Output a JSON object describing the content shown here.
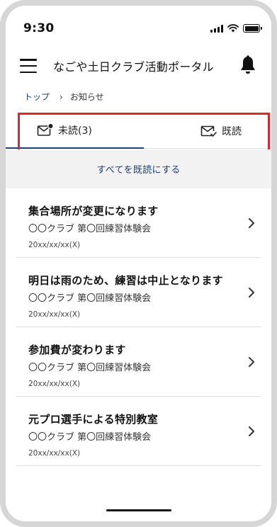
{
  "status_bar": {
    "time": "9:30"
  },
  "header": {
    "title": "なごや土日クラブ活動ポータル"
  },
  "breadcrumb": {
    "home": "トップ",
    "separator": "›",
    "current": "お知らせ"
  },
  "tabs": {
    "unread": "未読(3)",
    "read": "既読"
  },
  "mark_all_read": "すべてを既読にする",
  "notices": [
    {
      "title": "集合場所が変更になります",
      "club": "〇〇クラブ 第〇回練習体験会",
      "date": "20xx/xx/xx(X)"
    },
    {
      "title": "明日は雨のため、練習は中止となります",
      "club": "〇〇クラブ 第〇回練習体験会",
      "date": "20xx/xx/xx(X)"
    },
    {
      "title": "参加費が変わります",
      "club": "〇〇クラブ 第〇回練習体験会",
      "date": "20xx/xx/xx(X)"
    },
    {
      "title": "元プロ選手による特別教室",
      "club": "〇〇クラブ 第〇回練習体験会",
      "date": "20xx/xx/xx(X)"
    }
  ],
  "colors": {
    "accent": "#1f3f6e",
    "highlight": "#e0242c",
    "mark_all_bg": "#f2f2f2"
  },
  "icons": {
    "menu": "hamburger-menu-icon",
    "notification": "bell-icon",
    "unread": "mail-unread-icon",
    "read": "mail-check-icon",
    "item": "chevron-right-icon"
  }
}
